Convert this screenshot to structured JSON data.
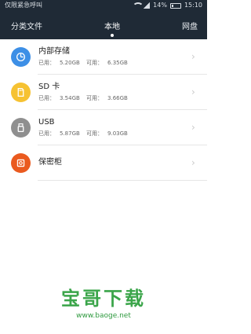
{
  "statusbar": {
    "left": "仅限紧急呼叫",
    "battery": "14%",
    "time": "15:10"
  },
  "tabs": [
    {
      "label": "分类文件"
    },
    {
      "label": "本地"
    },
    {
      "label": "网盘"
    }
  ],
  "storage": [
    {
      "name": "内部存储",
      "used_label": "已用：",
      "used": "5.20GB",
      "free_label": "可用：",
      "free": "6.35GB",
      "color": "#3d8fe6"
    },
    {
      "name": "SD 卡",
      "used_label": "已用：",
      "used": "3.54GB",
      "free_label": "可用：",
      "free": "3.66GB",
      "color": "#f6c232"
    },
    {
      "name": "USB",
      "used_label": "已用：",
      "used": "5.87GB",
      "free_label": "可用：",
      "free": "9.03GB",
      "color": "#8f8f8f"
    },
    {
      "name": "保密柜",
      "color": "#ea5a1f"
    }
  ],
  "watermark": {
    "title": "宝哥下载",
    "url": "www.baoge.net"
  }
}
